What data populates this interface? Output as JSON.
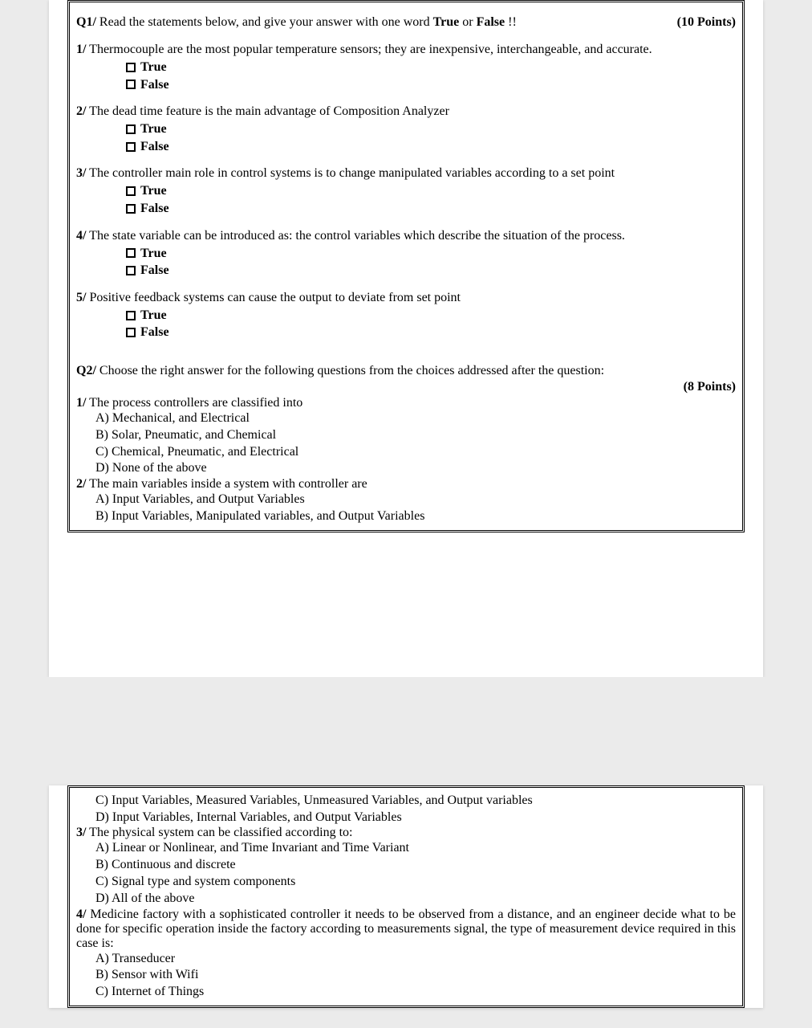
{
  "q1": {
    "label": "Q1/",
    "instruction_a": " Read the statements below, and give your answer with one word ",
    "true_word": "True",
    "or_word": " or ",
    "false_word": "False",
    "bangs": " !!",
    "points": "(10 Points)",
    "opt_true": "True",
    "opt_false": "False",
    "statements": [
      {
        "num": "1/",
        "text": " Thermocouple are the most popular temperature sensors; they are inexpensive, interchangeable, and accurate."
      },
      {
        "num": "2/",
        "text": " The dead time feature is the main advantage of Composition Analyzer"
      },
      {
        "num": "3/",
        "text": " The controller main role in control systems is to change manipulated variables according to a set point"
      },
      {
        "num": "4/",
        "text": " The state variable can be introduced as: the control variables which describe the situation of the process."
      },
      {
        "num": "5/",
        "text": " Positive feedback systems can cause the output to deviate from set point"
      }
    ]
  },
  "q2": {
    "label": "Q2/",
    "instruction": " Choose the right answer for the following questions from the choices addressed after the question:",
    "points": "(8 Points)",
    "items_p1": [
      {
        "num": "1/",
        "text": " The process controllers are classified into",
        "opts": [
          "A)  Mechanical, and Electrical",
          "B)  Solar, Pneumatic, and Chemical",
          "C)  Chemical, Pneumatic, and Electrical",
          "D)  None of the above"
        ]
      },
      {
        "num": "2/",
        "text": " The main variables inside a system with controller are",
        "opts": [
          "A)  Input Variables, and Output Variables",
          "B)  Input Variables, Manipulated variables, and Output Variables"
        ]
      }
    ],
    "items_p2_cont_opts": [
      "C)  Input Variables, Measured Variables, Unmeasured Variables, and Output variables",
      "D)  Input Variables, Internal Variables, and Output Variables"
    ],
    "items_p2": [
      {
        "num": "3/",
        "text": " The physical system can be classified according to:",
        "opts": [
          "A)  Linear or Nonlinear, and Time Invariant and Time Variant",
          "B)  Continuous and discrete",
          "C)  Signal type and system components",
          "D)  All of the above"
        ]
      },
      {
        "num": "4/",
        "text": " Medicine factory with a sophisticated controller it needs to be observed from a distance, and an engineer decide what to be done for specific operation inside the factory according to measurements signal, the type of measurement device required in this case is:",
        "justify": true,
        "opts": [
          "A)  Transeducer",
          "B)  Sensor with Wifi",
          "C)  Internet of Things"
        ]
      }
    ]
  }
}
